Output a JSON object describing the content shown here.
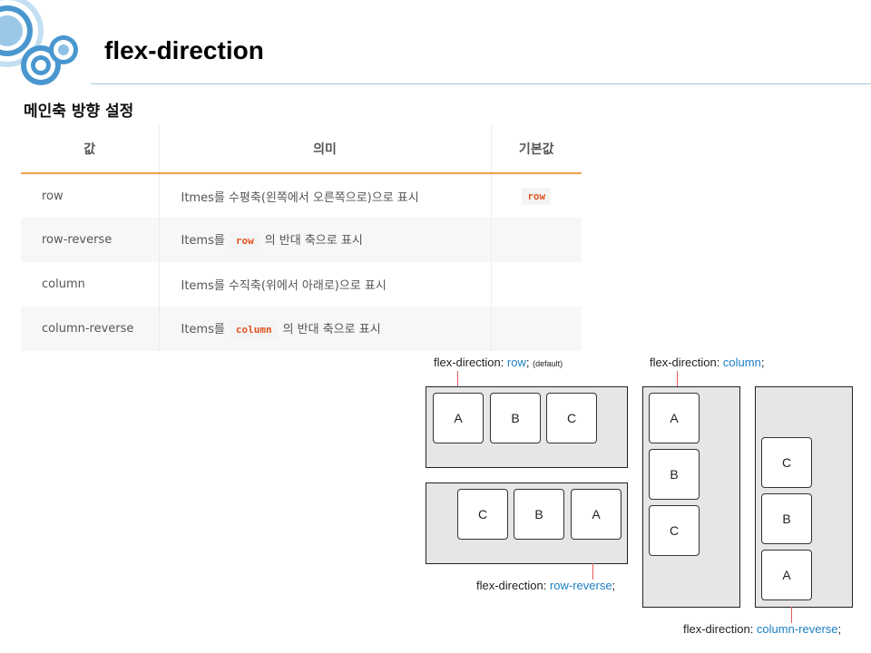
{
  "slide": {
    "title": "flex-direction",
    "subtitle": "메인축 방향 설정"
  },
  "table": {
    "headers": [
      "값",
      "의미",
      "기본값"
    ],
    "rows": [
      {
        "value": "row",
        "meaning_before": "Itmes를 수평축(왼쪽에서 오른쪽으로)으로 표시",
        "code": "",
        "meaning_after": "",
        "default": "row"
      },
      {
        "value": "row-reverse",
        "meaning_before": "Items를",
        "code": "row",
        "meaning_after": "의 반대 축으로 표시",
        "default": ""
      },
      {
        "value": "column",
        "meaning_before": "Items를 수직축(위에서 아래로)으로 표시",
        "code": "",
        "meaning_after": "",
        "default": ""
      },
      {
        "value": "column-reverse",
        "meaning_before": "Items를",
        "code": "column",
        "meaning_after": "의 반대 축으로 표시",
        "default": ""
      }
    ]
  },
  "diagram": {
    "row": {
      "prefix": "flex-direction: ",
      "kw": "row",
      "suffix": ";",
      "note": "(default)",
      "items": [
        "A",
        "B",
        "C"
      ]
    },
    "row_reverse": {
      "prefix": "flex-direction: ",
      "kw": "row-reverse",
      "suffix": ";",
      "items": [
        "C",
        "B",
        "A"
      ]
    },
    "column": {
      "prefix": "flex-direction: ",
      "kw": "column",
      "suffix": ";",
      "items": [
        "A",
        "B",
        "C"
      ]
    },
    "column_reverse": {
      "prefix": "flex-direction: ",
      "kw": "column-reverse",
      "suffix": ";",
      "items": [
        "C",
        "B",
        "A"
      ]
    }
  },
  "colors": {
    "keyword": "#1b7fc4",
    "accent": "#f0a24a",
    "code": "#e0531f",
    "tick": "#e25b5b"
  }
}
